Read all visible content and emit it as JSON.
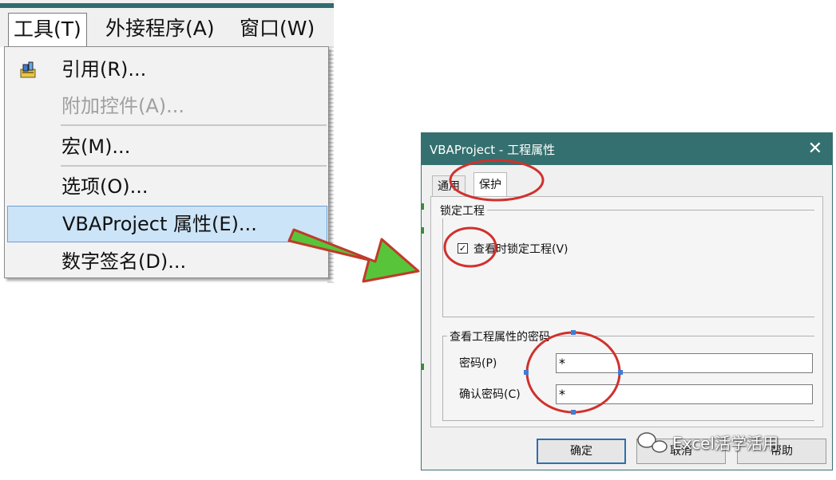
{
  "menubar": {
    "items": [
      {
        "label": "工具(T)",
        "active": true
      },
      {
        "label": "外接程序(A)",
        "active": false
      },
      {
        "label": "窗口(W)",
        "active": false
      }
    ]
  },
  "dropdown": {
    "items": [
      {
        "label": "引用(R)...",
        "icon": "references-icon",
        "disabled": false,
        "selected": false
      },
      {
        "label": "附加控件(A)...",
        "disabled": true,
        "selected": false
      },
      {
        "label": "宏(M)...",
        "disabled": false,
        "selected": false
      },
      {
        "label": "选项(O)...",
        "disabled": false,
        "selected": false
      },
      {
        "label": "VBAProject 属性(E)...",
        "disabled": false,
        "selected": true
      },
      {
        "label": "数字签名(D)...",
        "disabled": false,
        "selected": false
      }
    ]
  },
  "dialog": {
    "title": "VBAProject - 工程属性",
    "close_icon": "close-icon",
    "tabs": [
      {
        "label": "通用",
        "active": false
      },
      {
        "label": "保护",
        "active": true
      }
    ],
    "lock_group": {
      "label": "锁定工程",
      "checkbox_label": "查看时锁定工程(V)",
      "checked": true
    },
    "password_group": {
      "label": "查看工程属性的密码",
      "password_label": "密码(P)",
      "password_value": "*",
      "confirm_label": "确认密码(C)",
      "confirm_value": "*"
    },
    "buttons": {
      "ok": "确定",
      "cancel": "取消",
      "help": "帮助"
    }
  },
  "watermark": {
    "text": "Excel活学活用",
    "icon": "wechat-icon"
  },
  "colors": {
    "titlebar": "#34706f",
    "highlight": "#cce4f7",
    "annotation_red": "#d0312d",
    "arrow_green": "#58c43a"
  }
}
